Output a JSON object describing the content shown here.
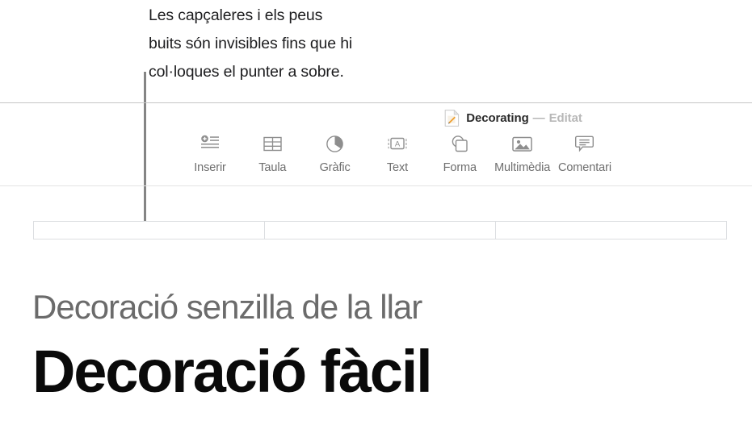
{
  "callout": {
    "text": "Les capçaleres i els peus\nbuits són invisibles fins que hi\ncol·loques el punter a sobre."
  },
  "titlebar": {
    "doc_icon": "pages-document-icon",
    "title": "Decorating",
    "separator": "—",
    "state": "Editat"
  },
  "toolbar": {
    "items": [
      {
        "icon": "insert-icon",
        "label": "Inserir"
      },
      {
        "icon": "table-icon",
        "label": "Taula"
      },
      {
        "icon": "chart-icon",
        "label": "Gràfic"
      },
      {
        "icon": "text-box-icon",
        "label": "Text"
      },
      {
        "icon": "shape-icon",
        "label": "Forma"
      },
      {
        "icon": "media-icon",
        "label": "Multimèdia"
      },
      {
        "icon": "comment-icon",
        "label": "Comentari"
      }
    ]
  },
  "header_fields": [
    {
      "name": "header-field-left",
      "value": ""
    },
    {
      "name": "header-field-center",
      "value": ""
    },
    {
      "name": "header-field-right",
      "value": ""
    }
  ],
  "document": {
    "subtitle": "Decoració senzilla de la llar",
    "headline": "Decoració fàcil"
  },
  "colors": {
    "callout_text": "#1d1d1f",
    "leader_line": "#858585",
    "toolbar_icon": "#898989",
    "toolbar_label": "#6e6e6e",
    "title_text": "#2b2b2b",
    "state_text": "#b8b8b8",
    "field_border": "#dcdee1",
    "subtitle": "#6b6b6b",
    "headline": "#0a0a0a",
    "doc_icon_accent": "#f0a030"
  }
}
